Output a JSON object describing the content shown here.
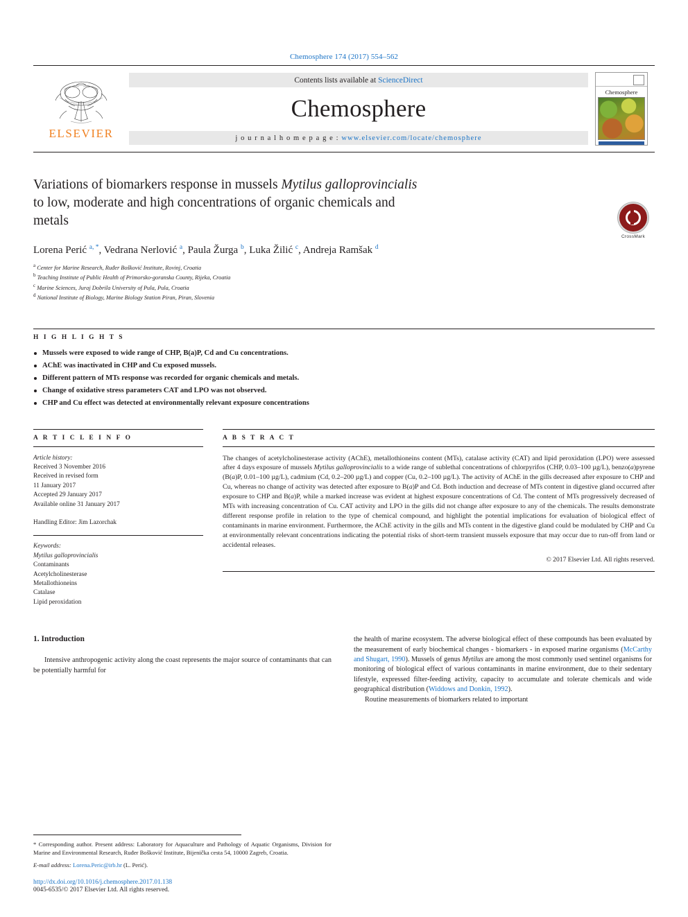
{
  "header": {
    "journal_ref": "Chemosphere 174 (2017) 554–562"
  },
  "masthead": {
    "elsevier_word": "ELSEVIER",
    "contents_prefix": "Contents lists available at ",
    "contents_link": "ScienceDirect",
    "journal_title": "Chemosphere",
    "homepage_prefix": "j o u r n a l   h o m e p a g e :   ",
    "homepage_url": "www.elsevier.com/locate/chemosphere",
    "cover_label": "Chemosphere"
  },
  "article": {
    "title_line1": "Variations of biomarkers response in mussels ",
    "title_italic1": "Mytilus galloprovincialis",
    "title_line2": "to low, moderate and high concentrations of organic chemicals and",
    "title_line3": "metals",
    "crossmark_label": "CrossMark",
    "authors": "Lorena Perić a, *, Vedrana Nerlović a, Paula Žurga b, Luka Žilić c, Andreja Ramšak d",
    "affiliations": [
      "a Center for Marine Research, Ruđer Bošković Institute, Rovinj, Croatia",
      "b Teaching Institute of Public Health of Primorsko-goranska County, Rijeka, Croatia",
      "c Marine Sciences, Juraj Dobrila University of Pula, Pula, Croatia",
      "d National Institute of Biology, Marine Biology Station Piran, Piran, Slovenia"
    ]
  },
  "highlights": {
    "heading": "H I G H L I G H T S",
    "items": [
      "Mussels were exposed to wide range of CHP, B(a)P, Cd and Cu concentrations.",
      "AChE was inactivated in CHP and Cu exposed mussels.",
      "Different pattern of MTs response was recorded for organic chemicals and metals.",
      "Change of oxidative stress parameters CAT and LPO was not observed.",
      "CHP and Cu effect was detected at environmentally relevant exposure concentrations"
    ]
  },
  "article_info": {
    "heading": "A R T I C L E   I N F O",
    "history_label": "Article history:",
    "history": [
      "Received 3 November 2016",
      "Received in revised form",
      "11 January 2017",
      "Accepted 29 January 2017",
      "Available online 31 January 2017"
    ],
    "handling_editor": "Handling Editor: Jim Lazorchak",
    "keywords_label": "Keywords:",
    "keywords": [
      "Mytilus galloprovincialis",
      "Contaminants",
      "Acetylcholinesterase",
      "Metallothioneins",
      "Catalase",
      "Lipid peroxidation"
    ]
  },
  "abstract": {
    "heading": "A B S T R A C T",
    "text": "The changes of acetylcholinesterase activity (AChE), metallothioneins content (MTs), catalase activity (CAT) and lipid peroxidation (LPO) were assessed after 4 days exposure of mussels Mytilus galloprovincialis to a wide range of sublethal concentrations of chlorpyrifos (CHP, 0.03–100 µg/L), benzo(a)pyrene (B(a)P, 0.01–100 µg/L), cadmium (Cd, 0.2–200 µg/L) and copper (Cu, 0.2–100 µg/L). The activity of AChE in the gills decreased after exposure to CHP and Cu, whereas no change of activity was detected after exposure to B(a)P and Cd. Both induction and decrease of MTs content in digestive gland occurred after exposure to CHP and B(a)P, while a marked increase was evident at highest exposure concentrations of Cd. The content of MTs progressively decreased of MTs with increasing concentration of Cu. CAT activity and LPO in the gills did not change after exposure to any of the chemicals. The results demonstrate different response profile in relation to the type of chemical compound, and highlight the potential implications for evaluation of biological effect of contaminants in marine environment. Furthermore, the AChE activity in the gills and MTs content in the digestive gland could be modulated by CHP and Cu at environmentally relevant concentrations indicating the potential risks of short-term transient mussels exposure that may occur due to run-off from land or accidental releases.",
    "copyright": "© 2017 Elsevier Ltd. All rights reserved."
  },
  "introduction": {
    "number_title": "1.  Introduction",
    "left_paragraph": "Intensive anthropogenic activity along the coast represents the major source of contaminants that can be potentially harmful for",
    "right_paragraph_1": "the health of marine ecosystem. The adverse biological effect of these compounds has been evaluated by the measurement of early biochemical changes - biomarkers - in exposed marine organisms (McCarthy and Shugart, 1990). Mussels of genus Mytilus are among the most commonly used sentinel organisms for monitoring of biological effect of various contaminants in marine environment, due to their sedentary lifestyle, expressed filter-feeding activity, capacity to accumulate and tolerate chemicals and wide geographical distribution (Widdows and Donkin, 1992).",
    "right_paragraph_2": "Routine measurements of biomarkers related to important",
    "citation_1": "McCarthy and Shugart, 1990",
    "citation_2": "Widdows and Donkin, 1992"
  },
  "footer": {
    "corresponding": "* Corresponding author. Present address: Laboratory for Aquaculture and Pathology of Aquatic Organisms, Division for Marine and Environmental Research, Ruđer Bošković Institute, Bijenička cesta 54, 10000 Zagreb, Croatia.",
    "email_label": "E-mail address: ",
    "email": "Lorena.Peric@irb.hr",
    "email_suffix": " (L. Perić).",
    "doi": "http://dx.doi.org/10.1016/j.chemosphere.2017.01.138",
    "issn": "0045-6535/© 2017 Elsevier Ltd. All rights reserved."
  },
  "colors": {
    "link": "#1a73c6",
    "elsevier_orange": "#f08020",
    "crossmark_red": "#8c1a1a"
  }
}
